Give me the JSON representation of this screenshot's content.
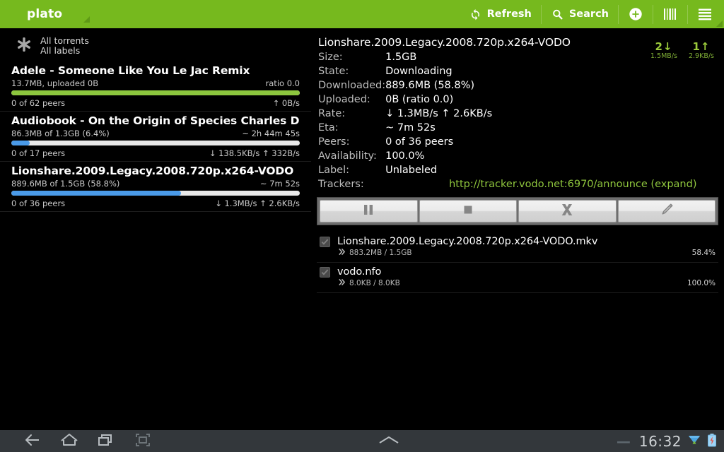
{
  "actionbar": {
    "app_title": "plato",
    "items": [
      {
        "label": "Refresh",
        "icon": "refresh-icon"
      },
      {
        "label": "Search",
        "icon": "search-icon"
      },
      {
        "label": "",
        "icon": "add-icon"
      },
      {
        "label": "",
        "icon": "barcode-icon"
      },
      {
        "label": "",
        "icon": "overflow-menu-icon"
      }
    ],
    "accent_green": "#76b91e"
  },
  "filter": {
    "icon": "asterisk-icon",
    "line1": "All torrents",
    "line2": "All labels"
  },
  "speeds": {
    "down_count": "2↓",
    "down_rate": "1.5MB/s",
    "up_count": "1↑",
    "up_rate": "2.9KB/s",
    "color": "#8fc63d"
  },
  "torrents": [
    {
      "name": "Adele - Someone Like You Le Jac Remix",
      "sub_left": "13.7MB, uploaded 0B",
      "sub_right": "ratio 0.0",
      "progress": 100,
      "bar_color": "#8cc63e",
      "foot_left": "0 of 62 peers",
      "foot_right": "↑ 0B/s"
    },
    {
      "name": "Audiobook - On the Origin of Species  Charles Darwin_",
      "sub_left": "86.3MB of 1.3GB (6.4%)",
      "sub_right": "~ 2h 44m 45s",
      "progress": 6.4,
      "bar_color": "#4a9ae8",
      "foot_left": "0 of 17 peers",
      "foot_right": "↓ 138.5KB/s ↑ 332B/s"
    },
    {
      "name": "Lionshare.2009.Legacy.2008.720p.x264-VODO",
      "sub_left": "889.6MB of 1.5GB (58.8%)",
      "sub_right": "~ 7m 52s",
      "progress": 58.8,
      "bar_color": "#4a9ae8",
      "foot_left": "0 of 36 peers",
      "foot_right": "↓ 1.3MB/s ↑ 2.6KB/s"
    }
  ],
  "details": {
    "title": "Lionshare.2009.Legacy.2008.720p.x264-VODO",
    "rows": [
      {
        "key": "Size:",
        "value": "1.5GB"
      },
      {
        "key": "State:",
        "value": "Downloading"
      },
      {
        "key": "Downloaded:",
        "value": "889.6MB (58.8%)"
      },
      {
        "key": "Uploaded:",
        "value": "0B (ratio 0.0)"
      },
      {
        "key": "Rate:",
        "value": "↓ 1.3MB/s ↑ 2.6KB/s"
      },
      {
        "key": "Eta:",
        "value": "~ 7m 52s"
      },
      {
        "key": "Peers:",
        "value": "0 of 36 peers"
      },
      {
        "key": "Availability:",
        "value": "100.0%"
      },
      {
        "key": "Label:",
        "value": "Unlabeled"
      }
    ],
    "trackers_key": "Trackers:",
    "trackers_value": "http://tracker.vodo.net:6970/announce (expand)",
    "trackers_color": "#8fc63d"
  },
  "buttons": [
    {
      "name": "pause-button",
      "icon": "pause-icon"
    },
    {
      "name": "stop-button",
      "icon": "stop-icon"
    },
    {
      "name": "remove-button",
      "icon": "close-x-icon"
    },
    {
      "name": "edit-button",
      "icon": "pencil-icon"
    }
  ],
  "files": [
    {
      "name": "Lionshare.2009.Legacy.2008.720p.x264-VODO.mkv",
      "size": "883.2MB / 1.5GB",
      "percent": "58.4%",
      "checked": true
    },
    {
      "name": "vodo.nfo",
      "size": "8.0KB / 8.0KB",
      "percent": "100.0%",
      "checked": true
    }
  ],
  "systembar": {
    "back": "back-icon",
    "home": "home-icon",
    "recents": "recent-apps-icon",
    "screenshot": "screenshot-icon",
    "notification_chevron": "chevron-up-icon",
    "dash": "—",
    "clock": "16:32",
    "wifi": "wifi-icon",
    "battery": "battery-charging-icon"
  }
}
